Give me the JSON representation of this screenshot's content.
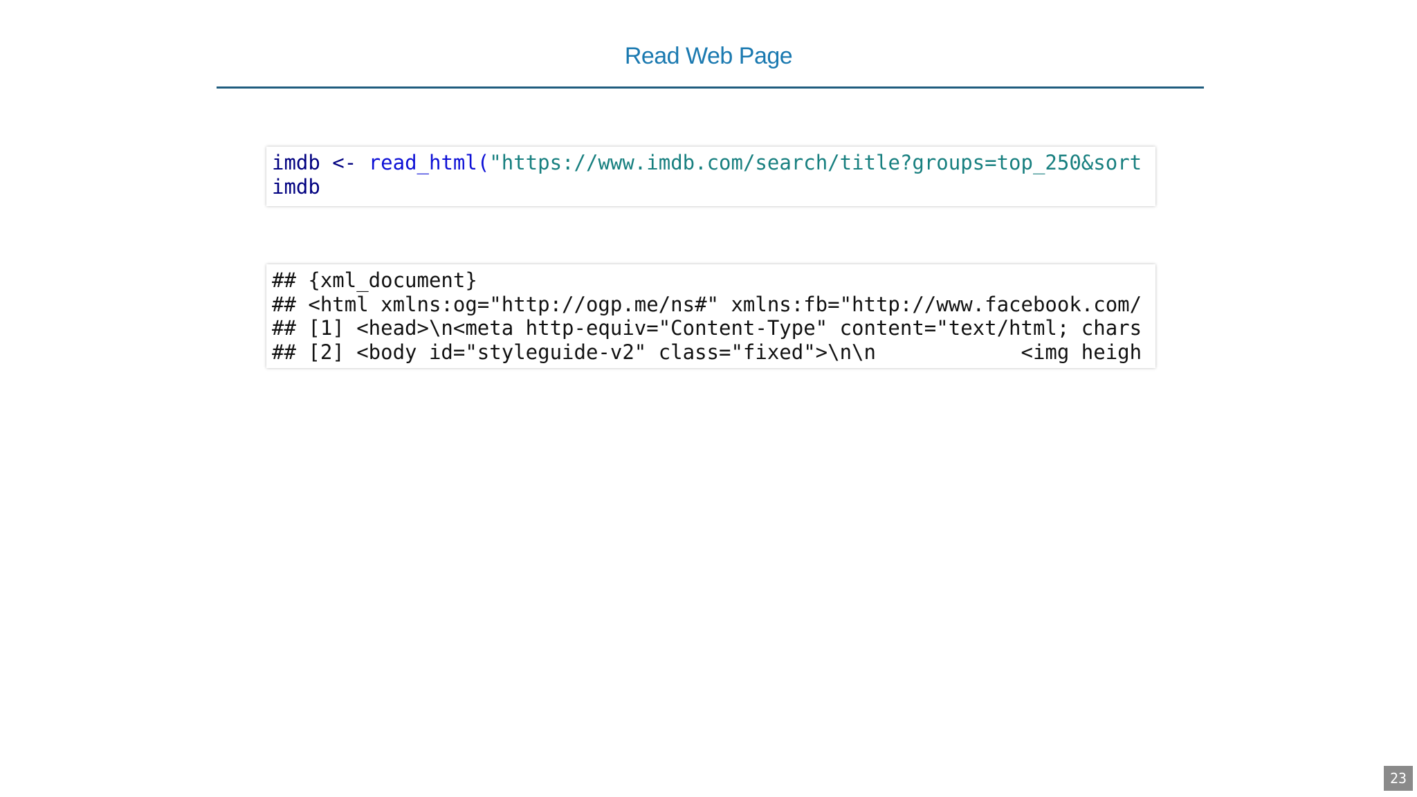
{
  "slide": {
    "title": "Read Web Page",
    "page_number": "23"
  },
  "source_code": {
    "line1": {
      "var": "imdb",
      "assign": " <- ",
      "func": "read_html",
      "paren": "(",
      "string": "\"https://www.imdb.com/search/title?groups=top_250&sort"
    },
    "line2": "imdb"
  },
  "output": {
    "lines": [
      "## {xml_document}",
      "## <html xmlns:og=\"http://ogp.me/ns#\" xmlns:fb=\"http://www.facebook.com/",
      "## [1] <head>\\n<meta http-equiv=\"Content-Type\" content=\"text/html; chars",
      "## [2] <body id=\"styleguide-v2\" class=\"fixed\">\\n\\n            <img heigh"
    ]
  },
  "colors": {
    "title": "#1a79b0",
    "rule": "#1f5c7e",
    "identifier": "#000080",
    "function": "#0d10d6",
    "string": "#177f7f",
    "page_badge": "#8a8a8a"
  }
}
